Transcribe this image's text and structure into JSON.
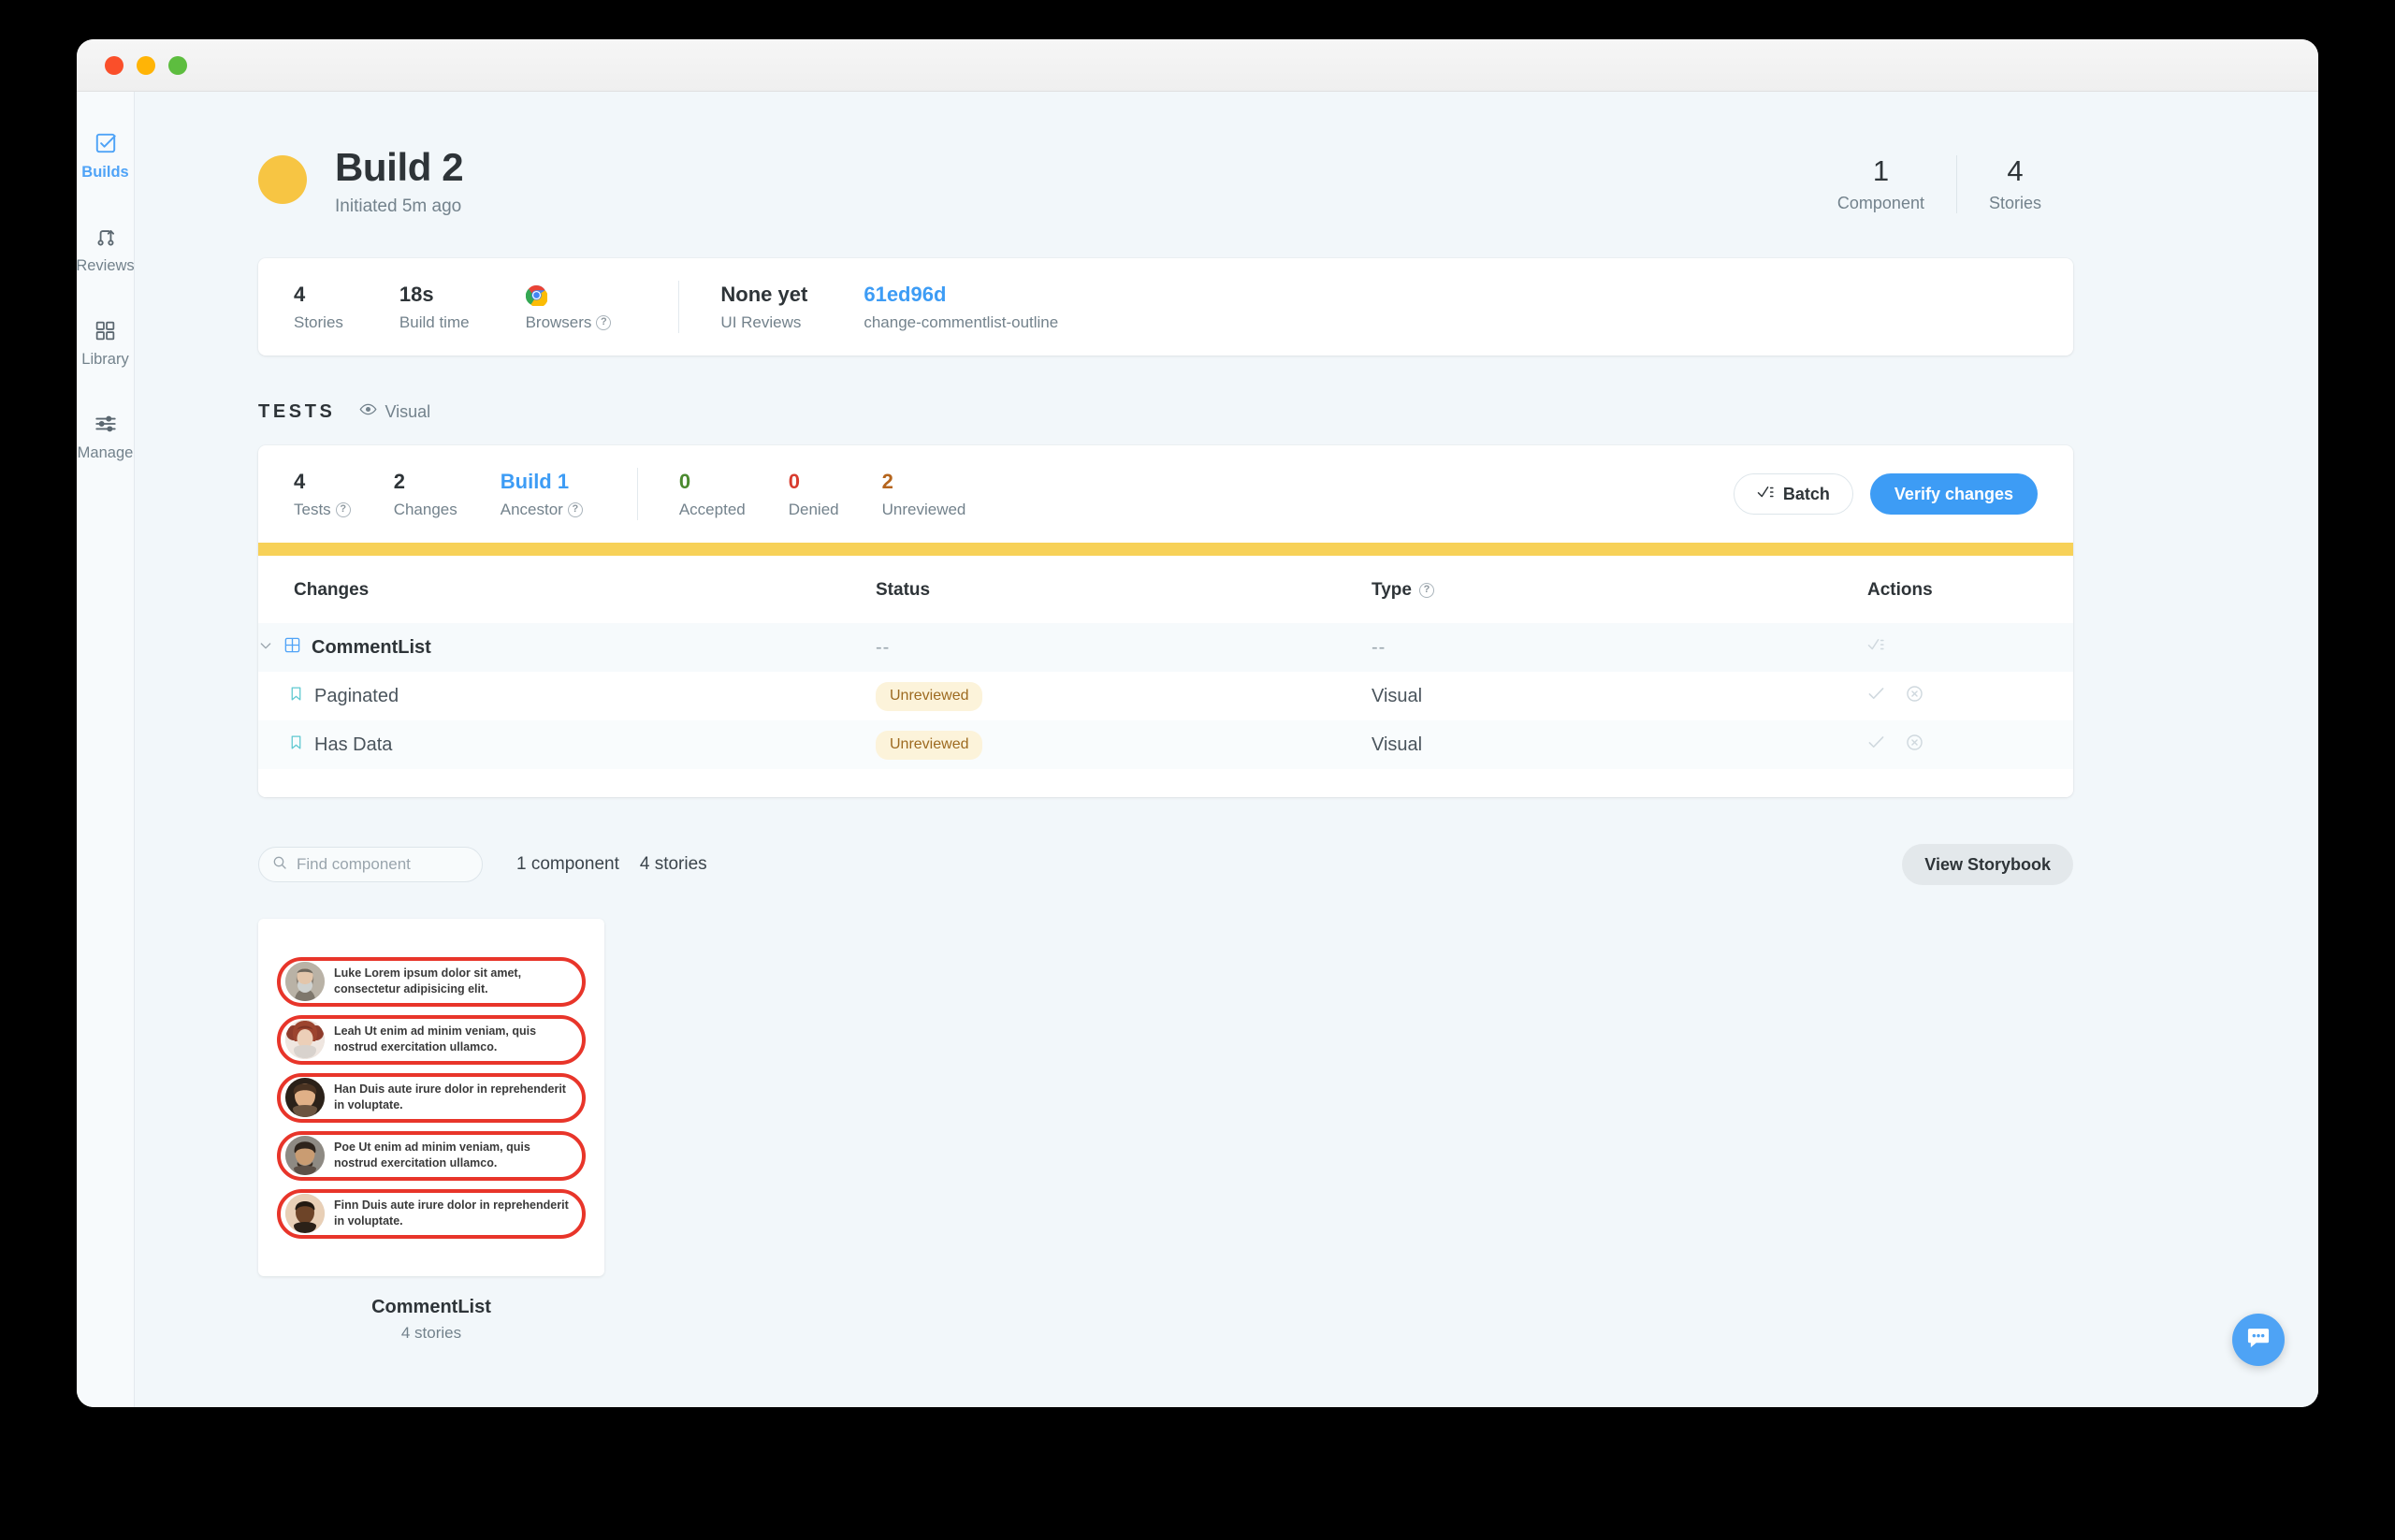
{
  "window": {
    "traffic_lights": [
      "close",
      "minimize",
      "maximize"
    ]
  },
  "sidebar": {
    "items": [
      {
        "label": "Builds",
        "icon": "checkbox-icon",
        "active": true
      },
      {
        "label": "Reviews",
        "icon": "branch-icon",
        "active": false
      },
      {
        "label": "Library",
        "icon": "grid-icon",
        "active": false
      },
      {
        "label": "Manage",
        "icon": "sliders-icon",
        "active": false
      }
    ]
  },
  "header": {
    "title": "Build 2",
    "subtitle": "Initiated 5m ago",
    "avatar_color": "#f7c543",
    "stats": [
      {
        "value": "1",
        "label": "Component"
      },
      {
        "value": "4",
        "label": "Stories"
      }
    ]
  },
  "summary": {
    "stats": [
      {
        "value": "4",
        "label": "Stories",
        "help": false,
        "icon": null
      },
      {
        "value": "18s",
        "label": "Build time",
        "help": false,
        "icon": null
      },
      {
        "value": "",
        "label": "Browsers",
        "help": true,
        "icon": "chrome-icon"
      }
    ],
    "right": [
      {
        "value": "None yet",
        "label": "UI Reviews",
        "link": false
      },
      {
        "value": "61ed96d",
        "label": "change-commentlist-outline",
        "link": true
      }
    ]
  },
  "tests": {
    "section_label": "TESTS",
    "kind_label": "Visual",
    "kind_icon": "eye-icon",
    "stats": [
      {
        "value": "4",
        "label": "Tests",
        "help": true,
        "style": "default"
      },
      {
        "value": "2",
        "label": "Changes",
        "help": false,
        "style": "default"
      },
      {
        "value": "Build 1",
        "label": "Ancestor",
        "help": true,
        "style": "link"
      },
      {
        "value": "0",
        "label": "Accepted",
        "help": false,
        "style": "accepted"
      },
      {
        "value": "0",
        "label": "Denied",
        "help": false,
        "style": "denied"
      },
      {
        "value": "2",
        "label": "Unreviewed",
        "help": false,
        "style": "unreviewed"
      }
    ],
    "batch_label": "Batch",
    "verify_label": "Verify changes",
    "progress_color": "#f7d158",
    "columns": {
      "changes": "Changes",
      "status": "Status",
      "type": "Type",
      "actions": "Actions"
    },
    "rows": [
      {
        "kind": "group",
        "name": "CommentList",
        "icon": "component-grid-icon",
        "status": "--",
        "type": "--",
        "actions": [
          "batch-check-icon"
        ]
      },
      {
        "kind": "story",
        "name": "Paginated",
        "icon": "bookmark-icon",
        "status": "Unreviewed",
        "type": "Visual",
        "actions": [
          "accept-check-icon",
          "deny-x-icon"
        ]
      },
      {
        "kind": "story",
        "name": "Has Data",
        "icon": "bookmark-icon",
        "status": "Unreviewed",
        "type": "Visual",
        "actions": [
          "accept-check-icon",
          "deny-x-icon"
        ]
      }
    ]
  },
  "browser": {
    "search_placeholder": "Find component",
    "search_value": "",
    "component_count": "1 component",
    "story_count": "4 stories",
    "view_storybook_label": "View Storybook"
  },
  "thumbnail": {
    "title": "CommentList",
    "subtitle": "4 stories",
    "outline_color": "#e8352a",
    "comments": [
      {
        "name": "Luke",
        "text": "Luke Lorem ipsum dolor sit amet, consectetur adipisicing elit.",
        "avatar_tone": "#9b9389"
      },
      {
        "name": "Leah",
        "text": "Leah Ut enim ad minim veniam, quis nostrud exercitation ullamco.",
        "avatar_tone": "#b7564a"
      },
      {
        "name": "Han",
        "text": "Han Duis aute irure dolor in reprehenderit in voluptate.",
        "avatar_tone": "#8a5a42"
      },
      {
        "name": "Poe",
        "text": "Poe Ut enim ad minim veniam, quis nostrud exercitation ullamco.",
        "avatar_tone": "#6f6257"
      },
      {
        "name": "Finn",
        "text": "Finn Duis aute irure dolor in reprehenderit in voluptate.",
        "avatar_tone": "#4a362b"
      }
    ]
  },
  "chat": {
    "icon": "chat-bubble-icon"
  }
}
